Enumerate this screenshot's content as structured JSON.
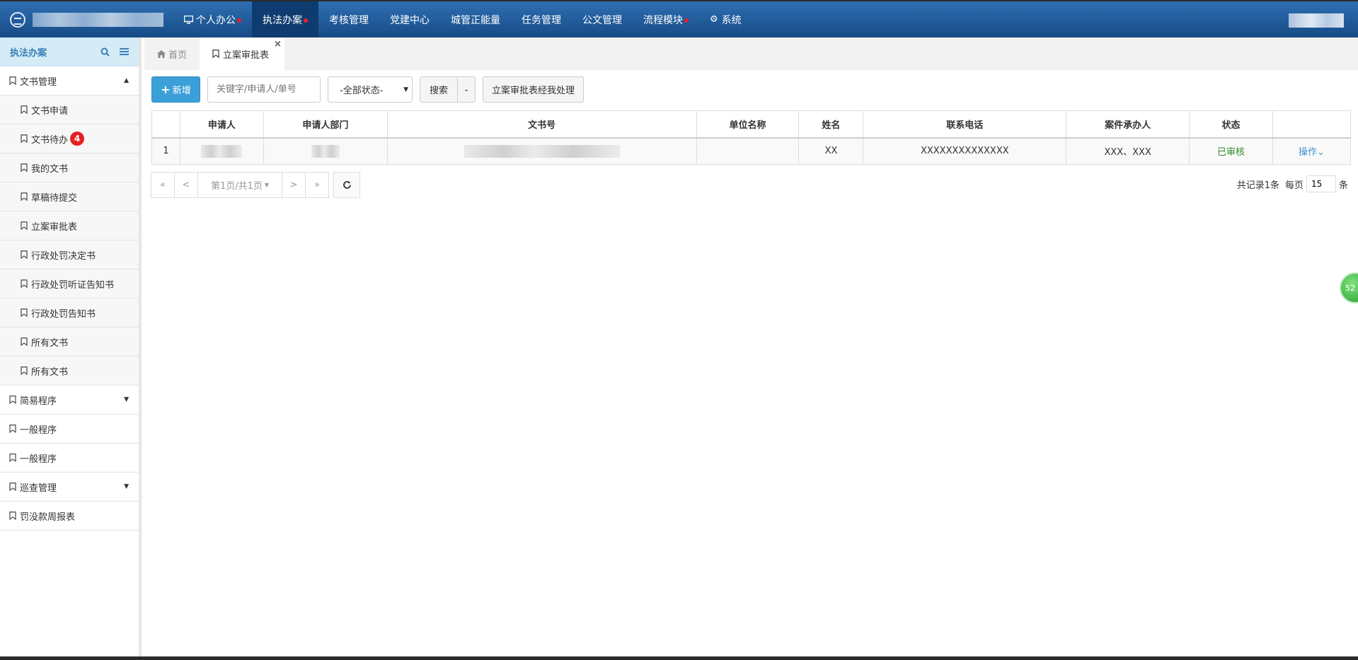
{
  "topnav": {
    "items": [
      {
        "label": "个人办公",
        "icon": "monitor-icon",
        "dot": true
      },
      {
        "label": "执法办案",
        "dot": true,
        "active": true
      },
      {
        "label": "考核管理"
      },
      {
        "label": "党建中心"
      },
      {
        "label": "城管正能量"
      },
      {
        "label": "任务管理"
      },
      {
        "label": "公文管理"
      },
      {
        "label": "流程模块",
        "dot": true
      },
      {
        "label": "系统",
        "icon": "gear-icon"
      }
    ]
  },
  "sidebar": {
    "title": "执法办案",
    "items": [
      {
        "label": "文书管理",
        "caret": "▲"
      },
      {
        "label": "文书申请",
        "sub": true
      },
      {
        "label": "文书待办",
        "sub": true,
        "badge": "4"
      },
      {
        "label": "我的文书",
        "sub": true
      },
      {
        "label": "草稿待提交",
        "sub": true
      },
      {
        "label": "立案审批表",
        "sub": true
      },
      {
        "label": "行政处罚决定书",
        "sub": true
      },
      {
        "label": "行政处罚听证告知书",
        "sub": true
      },
      {
        "label": "行政处罚告知书",
        "sub": true
      },
      {
        "label": "所有文书",
        "sub": true
      },
      {
        "label": "所有文书",
        "sub": true
      },
      {
        "label": "简易程序",
        "caret": "▼"
      },
      {
        "label": "一般程序"
      },
      {
        "label": "一般程序"
      },
      {
        "label": "巡查管理",
        "caret": "▼"
      },
      {
        "label": "罚没款周报表"
      }
    ]
  },
  "tabs": {
    "home": "首页",
    "active": "立案审批表",
    "close": "×"
  },
  "toolbar": {
    "add_label": "新增",
    "search_placeholder": "关键字/申请人/单号",
    "status_select": "-全部状态-",
    "search_label": "搜索",
    "handled_label": "立案审批表经我处理"
  },
  "table": {
    "columns": [
      "申请人",
      "申请人部门",
      "文书号",
      "单位名称",
      "姓名",
      "联系电话",
      "案件承办人",
      "状态",
      ""
    ],
    "rows": [
      {
        "index": "1",
        "name": "XX",
        "phone": "XXXXXXXXXXXXXX",
        "handler": "XXX、XXX",
        "status": "已审核",
        "op": "操作"
      }
    ]
  },
  "pager": {
    "first": "«",
    "prev": "<",
    "page_info": "第1页/共1页",
    "next": ">",
    "last": "»",
    "records_prefix": "共记录1条",
    "per_page_label": "每页",
    "per_page_value": "15",
    "per_page_suffix": "条"
  },
  "float_ball": "52",
  "colors": {
    "topbar": "#1f5a99",
    "active_nav": "#0f3c70",
    "primary_button": "#3ca0d8",
    "status_ok": "#2f8a2f",
    "badge": "#e52020"
  }
}
